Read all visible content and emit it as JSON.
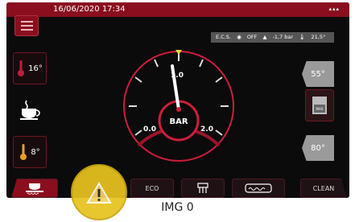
{
  "header": {
    "datetime": "16/06/2020 17:34"
  },
  "status_strip": {
    "ecs": "E.C.S.",
    "mode": "OFF",
    "pressure": "-1,7 bar",
    "temp": "21,5°"
  },
  "left": {
    "temp_top": "16°",
    "temp_bottom": "8°"
  },
  "gauge": {
    "label": "BAR",
    "ticks": [
      "0.0",
      "1.0",
      "2.0"
    ],
    "value_bar": 1.0
  },
  "right": {
    "top_value": "55°",
    "bottom_value": "80°",
    "box_label": "MAX"
  },
  "bottombar": {
    "eco_label": "ECO",
    "clean_label": "CLEAN"
  },
  "caption": "IMG 0",
  "colors": {
    "accent": "#8a0e1e",
    "gauge_ring": "#cf1d3a",
    "warning": "#e7c21e"
  }
}
